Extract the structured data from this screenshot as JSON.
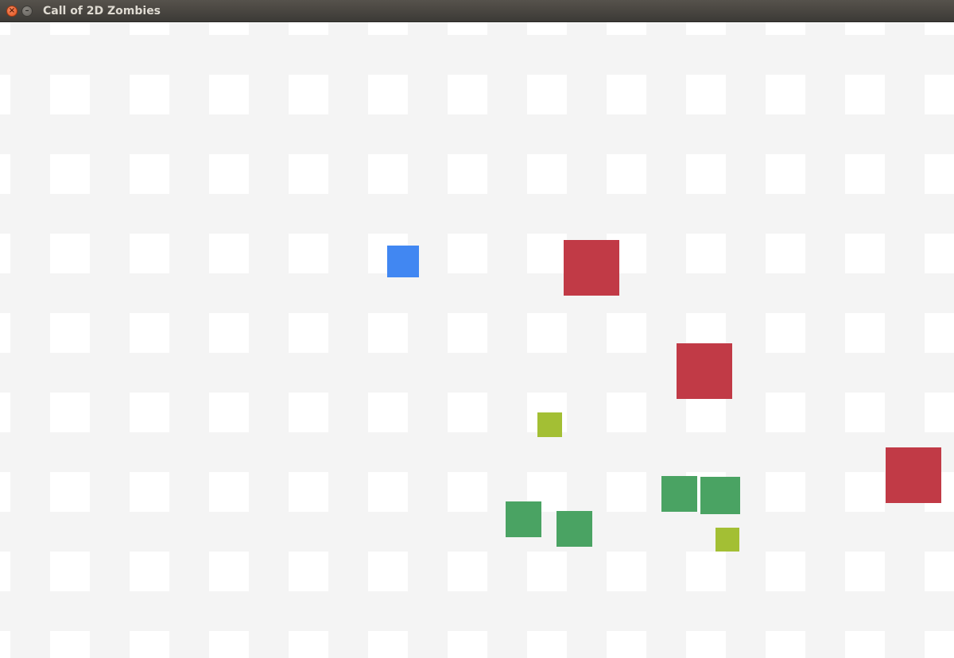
{
  "window": {
    "title": "Call of 2D Zombies",
    "close_icon_glyph": "×",
    "minimize_icon_glyph": "–"
  },
  "colors": {
    "floor": "#f4f4f4",
    "tile": "#ffffff",
    "player": "#4187f2",
    "zombie": "#c13a46",
    "ally": "#4aa363",
    "pickup": "#a3bf34"
  },
  "entities": {
    "player_count": 1,
    "zombie_count": 3,
    "ally_count": 4,
    "pickup_count": 2
  }
}
